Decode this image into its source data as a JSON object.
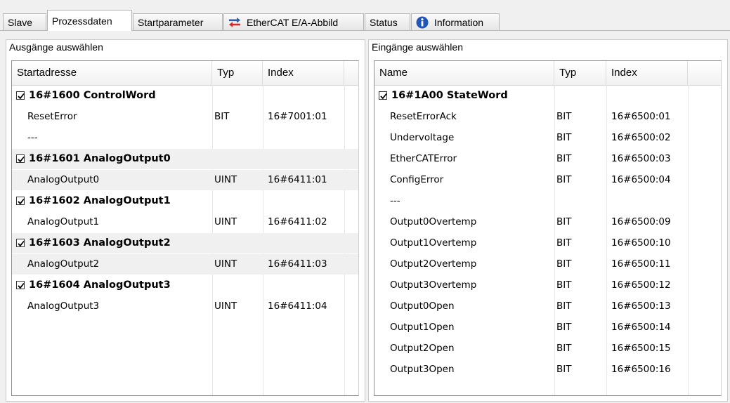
{
  "tabs": [
    {
      "label": "Slave"
    },
    {
      "label": "Prozessdaten"
    },
    {
      "label": "Startparameter"
    },
    {
      "label": "EtherCAT E/A-Abbild"
    },
    {
      "label": "Status"
    },
    {
      "label": "Information"
    }
  ],
  "colors": {
    "accent_blue": "#2a5fb0",
    "accent_red": "#d42a2a",
    "info_blue": "#1f56b8"
  },
  "outputs": {
    "title": "Ausgänge auswählen",
    "columns": [
      "Startadresse",
      "Typ",
      "Index"
    ],
    "rows": [
      {
        "name": "16#1600 ControlWord",
        "type": "",
        "index": "",
        "group": true,
        "checked": true
      },
      {
        "name": "ResetError",
        "type": "BIT",
        "index": "16#7001:01"
      },
      {
        "name": "---",
        "type": "",
        "index": ""
      },
      {
        "name": "16#1601 AnalogOutput0",
        "type": "",
        "index": "",
        "group": true,
        "checked": true
      },
      {
        "name": "AnalogOutput0",
        "type": "UINT",
        "index": "16#6411:01"
      },
      {
        "name": "16#1602 AnalogOutput1",
        "type": "",
        "index": "",
        "group": true,
        "checked": true
      },
      {
        "name": "AnalogOutput1",
        "type": "UINT",
        "index": "16#6411:02"
      },
      {
        "name": "16#1603 AnalogOutput2",
        "type": "",
        "index": "",
        "group": true,
        "checked": true
      },
      {
        "name": "AnalogOutput2",
        "type": "UINT",
        "index": "16#6411:03"
      },
      {
        "name": "16#1604 AnalogOutput3",
        "type": "",
        "index": "",
        "group": true,
        "checked": true
      },
      {
        "name": "AnalogOutput3",
        "type": "UINT",
        "index": "16#6411:04"
      }
    ]
  },
  "inputs": {
    "title": "Eingänge auswählen",
    "columns": [
      "Name",
      "Typ",
      "Index"
    ],
    "rows": [
      {
        "name": "16#1A00 StateWord",
        "type": "",
        "index": "",
        "group": true,
        "checked": true
      },
      {
        "name": "ResetErrorAck",
        "type": "BIT",
        "index": "16#6500:01"
      },
      {
        "name": "Undervoltage",
        "type": "BIT",
        "index": "16#6500:02"
      },
      {
        "name": "EtherCATError",
        "type": "BIT",
        "index": "16#6500:03"
      },
      {
        "name": "ConfigError",
        "type": "BIT",
        "index": "16#6500:04"
      },
      {
        "name": "---",
        "type": "",
        "index": ""
      },
      {
        "name": "Output0Overtemp",
        "type": "BIT",
        "index": "16#6500:09"
      },
      {
        "name": "Output1Overtemp",
        "type": "BIT",
        "index": "16#6500:10"
      },
      {
        "name": "Output2Overtemp",
        "type": "BIT",
        "index": "16#6500:11"
      },
      {
        "name": "Output3Overtemp",
        "type": "BIT",
        "index": "16#6500:12"
      },
      {
        "name": "Output0Open",
        "type": "BIT",
        "index": "16#6500:13"
      },
      {
        "name": "Output1Open",
        "type": "BIT",
        "index": "16#6500:14"
      },
      {
        "name": "Output2Open",
        "type": "BIT",
        "index": "16#6500:15"
      },
      {
        "name": "Output3Open",
        "type": "BIT",
        "index": "16#6500:16"
      }
    ]
  }
}
